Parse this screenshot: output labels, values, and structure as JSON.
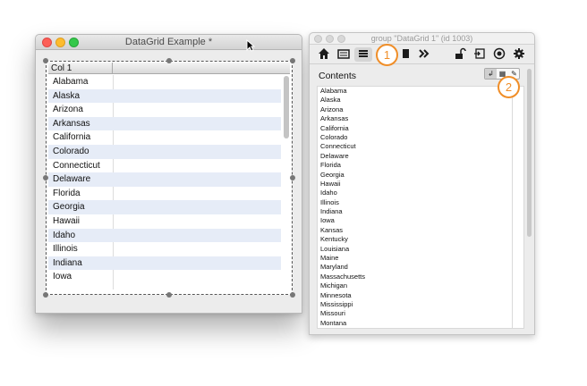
{
  "left_window": {
    "title": "DataGrid Example *",
    "column_header": "Col 1",
    "rows": [
      "Alabama",
      "Alaska",
      "Arizona",
      "Arkansas",
      "California",
      "Colorado",
      "Connecticut",
      "Delaware",
      "Florida",
      "Georgia",
      "Hawaii",
      "Idaho",
      "Illinois",
      "Indiana",
      "Iowa"
    ]
  },
  "right_window": {
    "title": "group \"DataGrid 1\" (id 1003)",
    "toolbar_icons": [
      "home-icon",
      "card-icon",
      "list-icon",
      "grid-icon",
      "forward-icon",
      "unlock-icon",
      "export-icon",
      "target-icon",
      "gear-icon"
    ],
    "contents_label": "Contents",
    "mini_buttons": [
      "wrap-icon",
      "table-icon",
      "edit-icon"
    ],
    "contents_lines": [
      "Alabama",
      "Alaska",
      "Arizona",
      "Arkansas",
      "California",
      "Colorado",
      "Connecticut",
      "Delaware",
      "Florida",
      "Georgia",
      "Hawaii",
      "Idaho",
      "Illinois",
      "Indiana",
      "Iowa",
      "Kansas",
      "Kentucky",
      "Louisiana",
      "Maine",
      "Maryland",
      "Massachusetts",
      "Michigan",
      "Minnesota",
      "Mississippi",
      "Missouri",
      "Montana"
    ]
  },
  "callouts": [
    "1",
    "2"
  ],
  "colors": {
    "callout": "#f08e28",
    "row_alt": "#e6ecf7"
  }
}
